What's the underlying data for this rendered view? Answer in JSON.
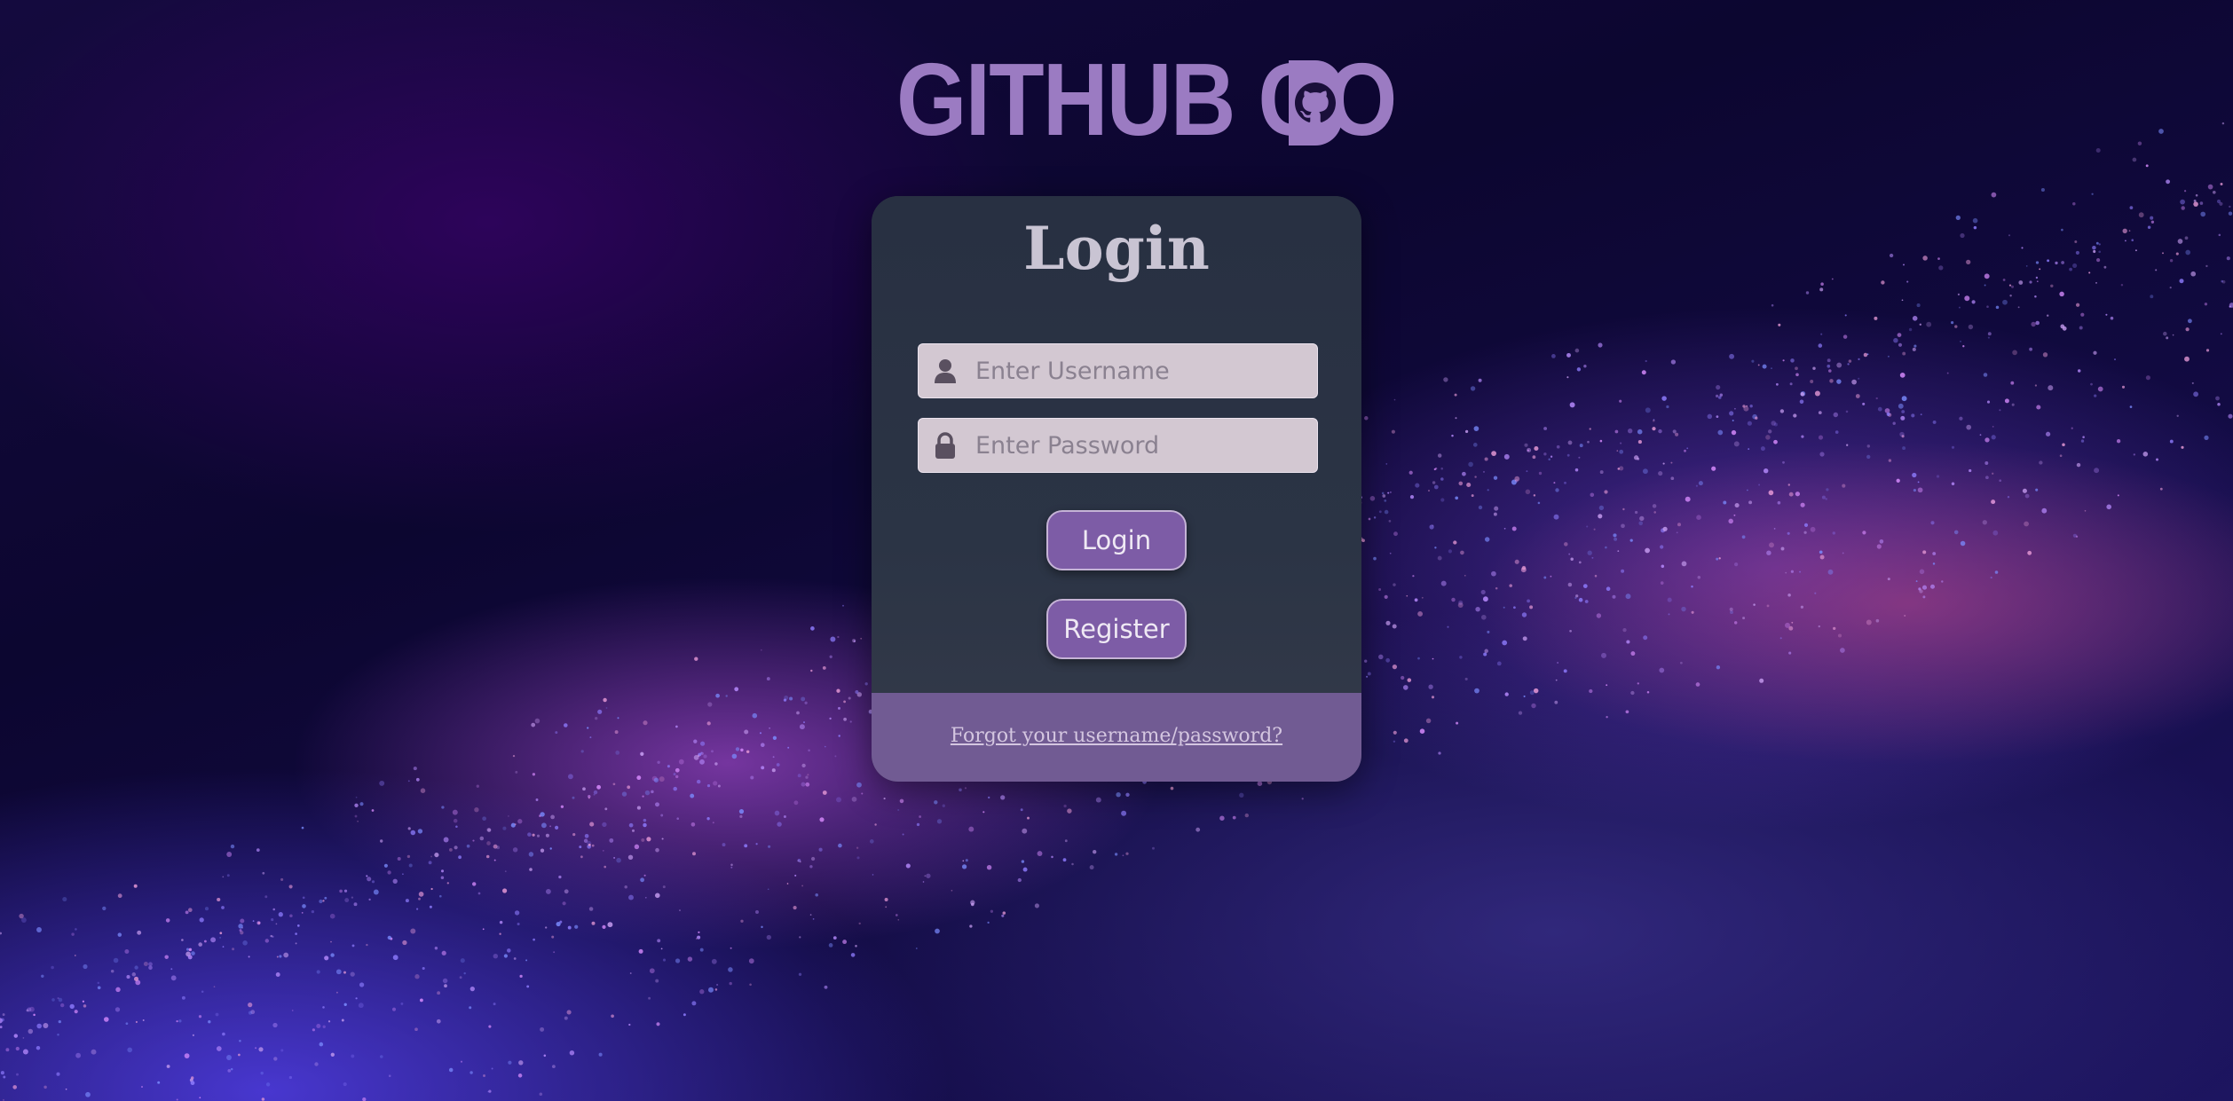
{
  "brand": {
    "logo_text": "GITHUB GO",
    "logo_color": "#9b7bc2",
    "logo_icon": "octocat-icon"
  },
  "login_card": {
    "title": "Login",
    "username": {
      "icon": "user-icon",
      "placeholder": "Enter Username",
      "value": ""
    },
    "password": {
      "icon": "lock-icon",
      "placeholder": "Enter Password",
      "value": ""
    },
    "login_button": "Login",
    "register_button": "Register",
    "forgot_link": "Forgot your username/password?"
  },
  "colors": {
    "card_bg": "#2a3140",
    "footer_bg": "#715b93",
    "button_bg": "#7d5ca6",
    "input_bg": "#d3c8d2"
  }
}
